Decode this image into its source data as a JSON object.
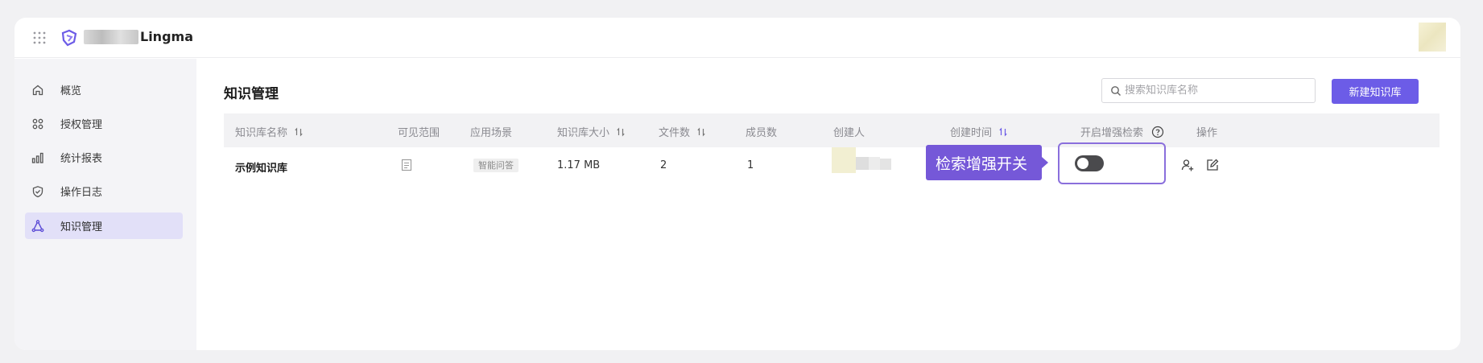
{
  "brand": {
    "name": "Lingma"
  },
  "sidebar": {
    "items": [
      {
        "label": "概览",
        "icon": "home-icon"
      },
      {
        "label": "授权管理",
        "icon": "apps-icon"
      },
      {
        "label": "统计报表",
        "icon": "bar-chart-icon"
      },
      {
        "label": "操作日志",
        "icon": "shield-check-icon"
      },
      {
        "label": "知识管理",
        "icon": "knowledge-icon",
        "active": true
      }
    ]
  },
  "main": {
    "title": "知识管理",
    "search": {
      "placeholder": "搜索知识库名称",
      "value": ""
    },
    "new_button": "新建知识库",
    "table": {
      "columns": [
        "知识库名称",
        "可见范围",
        "应用场景",
        "知识库大小",
        "文件数",
        "成员数",
        "创建人",
        "创建时间",
        "开启增强检索",
        "操作"
      ],
      "rows": [
        {
          "name": "示例知识库",
          "visibility_icon": "document-icon",
          "scene": "智能问答",
          "size": "1.17 MB",
          "files": "2",
          "members": "1",
          "enhanced_search": false
        }
      ]
    },
    "callout": "检索增强开关"
  },
  "colors": {
    "accent": "#6c5ce7",
    "callout": "#7558d8",
    "sidebar_active": "#e2e0f8"
  }
}
